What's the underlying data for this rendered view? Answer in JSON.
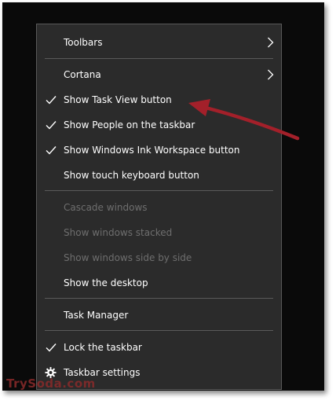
{
  "menu": {
    "items": [
      {
        "label": "Toolbars",
        "submenu": true,
        "checked": false,
        "disabled": false
      },
      {
        "label": "Cortana",
        "submenu": true,
        "checked": false,
        "disabled": false
      },
      {
        "label": "Show Task View button",
        "submenu": false,
        "checked": true,
        "disabled": false
      },
      {
        "label": "Show People on the taskbar",
        "submenu": false,
        "checked": true,
        "disabled": false
      },
      {
        "label": "Show Windows Ink Workspace button",
        "submenu": false,
        "checked": true,
        "disabled": false
      },
      {
        "label": "Show touch keyboard button",
        "submenu": false,
        "checked": false,
        "disabled": false
      },
      {
        "label": "Cascade windows",
        "submenu": false,
        "checked": false,
        "disabled": true
      },
      {
        "label": "Show windows stacked",
        "submenu": false,
        "checked": false,
        "disabled": true
      },
      {
        "label": "Show windows side by side",
        "submenu": false,
        "checked": false,
        "disabled": true
      },
      {
        "label": "Show the desktop",
        "submenu": false,
        "checked": false,
        "disabled": false
      },
      {
        "label": "Task Manager",
        "submenu": false,
        "checked": false,
        "disabled": false
      },
      {
        "label": "Lock the taskbar",
        "submenu": false,
        "checked": true,
        "disabled": false
      },
      {
        "label": "Taskbar settings",
        "submenu": false,
        "checked": false,
        "disabled": false,
        "icon": "gear-icon"
      }
    ]
  },
  "watermark": "TrySoda.com",
  "colors": {
    "menu_bg": "#2b2b2b",
    "text": "#ffffff",
    "disabled_text": "#6e6e6e",
    "separator": "#5a5a5a",
    "annotation_arrow": "#a3202a"
  }
}
